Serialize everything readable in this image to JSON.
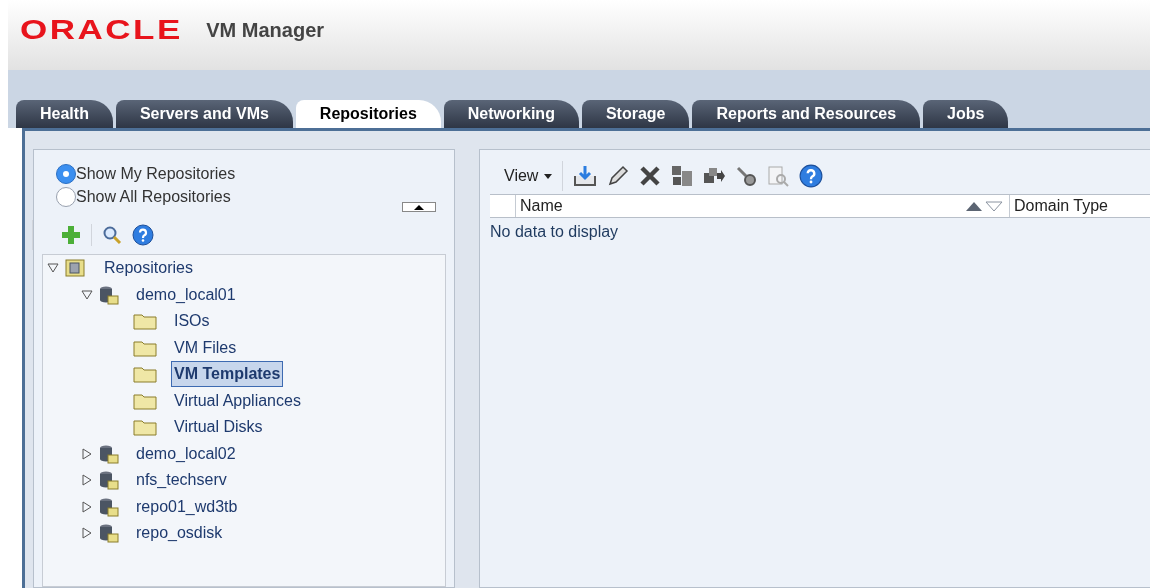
{
  "header": {
    "logo": "ORACLE",
    "product": "VM Manager"
  },
  "tabs": [
    {
      "label": "Health",
      "selected": false
    },
    {
      "label": "Servers and VMs",
      "selected": false
    },
    {
      "label": "Repositories",
      "selected": true
    },
    {
      "label": "Networking",
      "selected": false
    },
    {
      "label": "Storage",
      "selected": false
    },
    {
      "label": "Reports and Resources",
      "selected": false
    },
    {
      "label": "Jobs",
      "selected": false
    }
  ],
  "left_panel": {
    "radios": [
      {
        "label": "Show My Repositories",
        "selected": true
      },
      {
        "label": "Show All Repositories",
        "selected": false
      }
    ],
    "tree": [
      {
        "label": "Repositories",
        "kind": "root",
        "expanded": true,
        "selected": false,
        "children": [
          {
            "label": "demo_local01",
            "kind": "repository",
            "expanded": true,
            "selected": false,
            "children": [
              {
                "label": "ISOs",
                "kind": "folder",
                "selected": false
              },
              {
                "label": "VM Files",
                "kind": "folder",
                "selected": false
              },
              {
                "label": "VM Templates",
                "kind": "folder",
                "selected": true
              },
              {
                "label": "Virtual Appliances",
                "kind": "folder",
                "selected": false
              },
              {
                "label": "Virtual Disks",
                "kind": "folder",
                "selected": false
              }
            ]
          },
          {
            "label": "demo_local02",
            "kind": "repository",
            "expanded": false,
            "selected": false
          },
          {
            "label": "nfs_techserv",
            "kind": "repository",
            "expanded": false,
            "selected": false
          },
          {
            "label": "repo01_wd3tb",
            "kind": "repository",
            "expanded": false,
            "selected": false
          },
          {
            "label": "repo_osdisk",
            "kind": "repository",
            "expanded": false,
            "selected": false
          }
        ]
      }
    ]
  },
  "right_panel": {
    "view_menu": "View",
    "table": {
      "columns": [
        "Name",
        "Domain Type"
      ],
      "empty_message": "No data to display"
    }
  }
}
